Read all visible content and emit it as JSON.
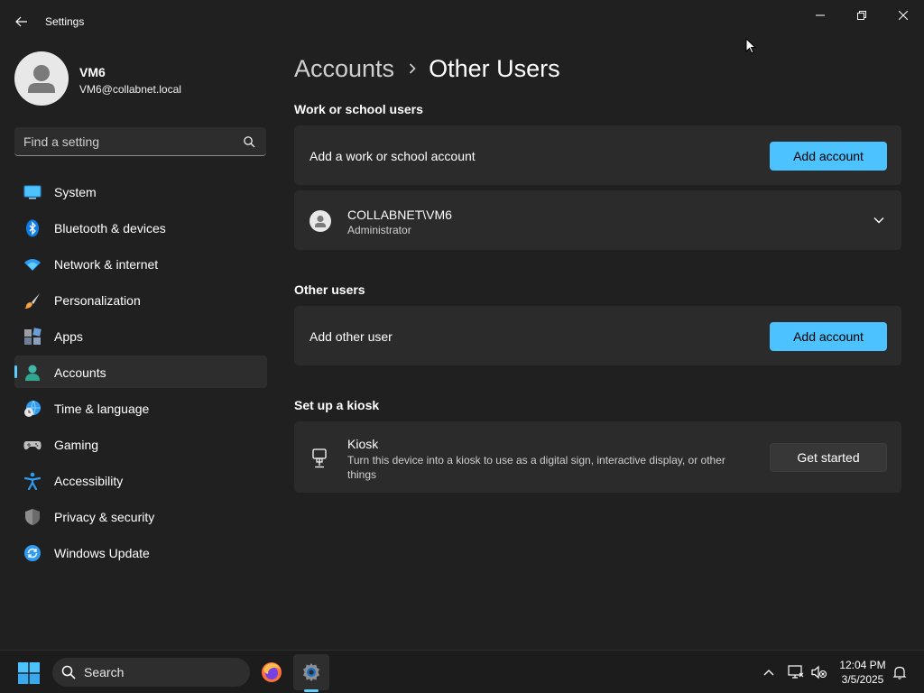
{
  "window": {
    "title": "Settings",
    "controls": {
      "minimize": "minimize-icon",
      "maximize": "restore-icon",
      "close": "close-icon"
    }
  },
  "profile": {
    "name": "VM6",
    "email": "VM6@collabnet.local"
  },
  "search": {
    "placeholder": "Find a setting"
  },
  "sidebar": {
    "items": [
      {
        "label": "System",
        "icon": "system-icon"
      },
      {
        "label": "Bluetooth & devices",
        "icon": "bluetooth-icon"
      },
      {
        "label": "Network & internet",
        "icon": "wifi-icon"
      },
      {
        "label": "Personalization",
        "icon": "brush-icon"
      },
      {
        "label": "Apps",
        "icon": "apps-icon"
      },
      {
        "label": "Accounts",
        "icon": "accounts-icon",
        "active": true
      },
      {
        "label": "Time & language",
        "icon": "globe-clock-icon"
      },
      {
        "label": "Gaming",
        "icon": "gamepad-icon"
      },
      {
        "label": "Accessibility",
        "icon": "accessibility-icon"
      },
      {
        "label": "Privacy & security",
        "icon": "shield-icon"
      },
      {
        "label": "Windows Update",
        "icon": "update-icon"
      }
    ]
  },
  "breadcrumb": {
    "parent": "Accounts",
    "current": "Other Users"
  },
  "work_school": {
    "section_title": "Work or school users",
    "add_label": "Add a work or school account",
    "add_button": "Add account",
    "user": {
      "name": "COLLABNET\\VM6",
      "role": "Administrator"
    }
  },
  "other_users": {
    "section_title": "Other users",
    "add_label": "Add other user",
    "add_button": "Add account"
  },
  "kiosk": {
    "section_title": "Set up a kiosk",
    "title": "Kiosk",
    "description": "Turn this device into a kiosk to use as a digital sign, interactive display, or other things",
    "button": "Get started"
  },
  "taskbar": {
    "search_label": "Search",
    "time": "12:04 PM",
    "date": "3/5/2025"
  },
  "colors": {
    "accent": "#4cc2ff",
    "background": "#202020",
    "card": "#2b2b2b"
  }
}
